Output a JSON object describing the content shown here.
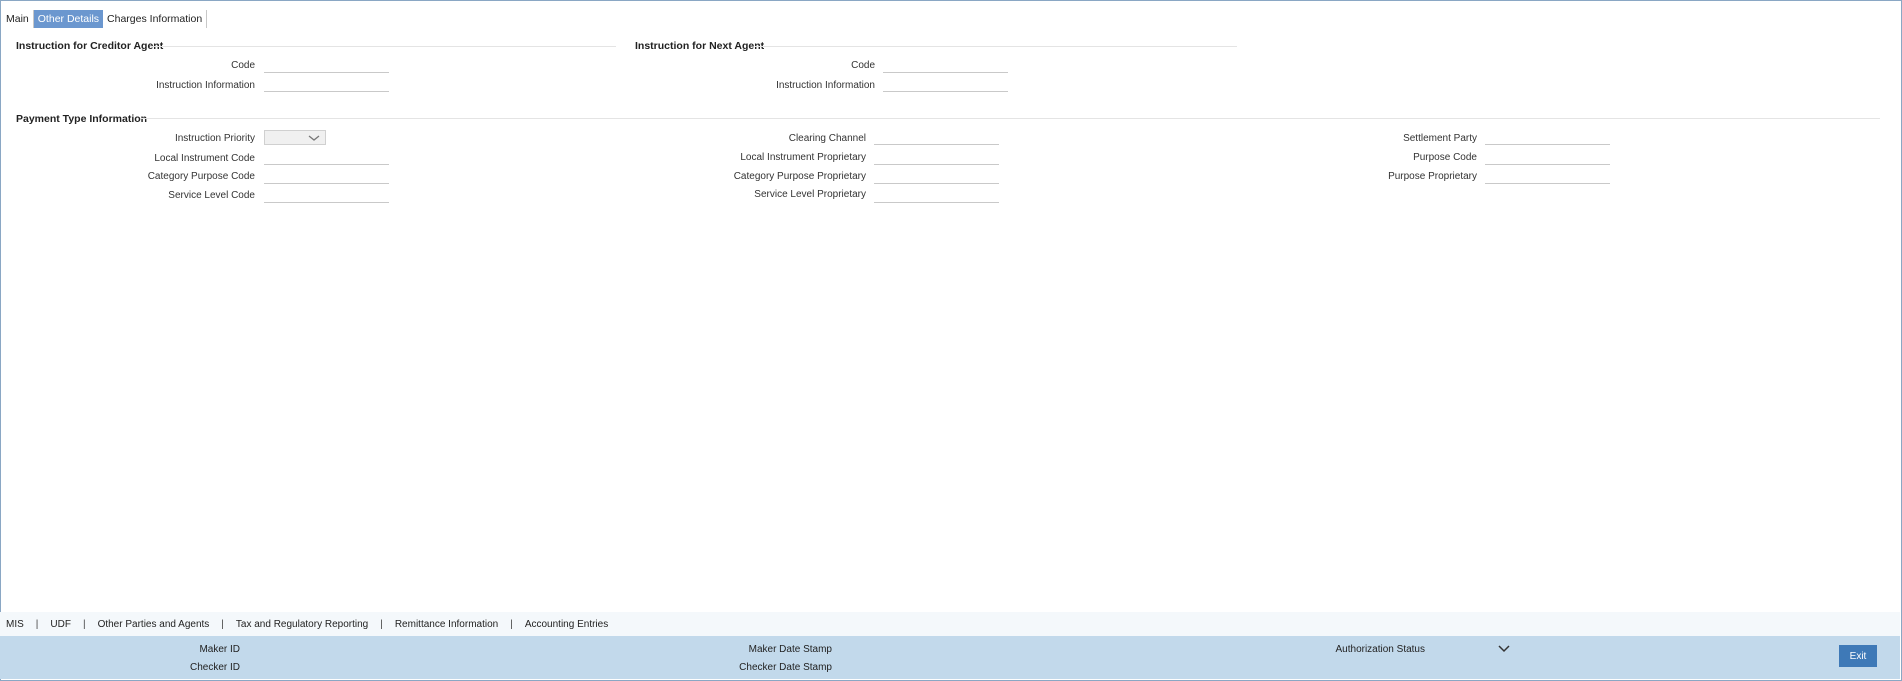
{
  "tabs": [
    "Main",
    "Other Details",
    "Charges Information"
  ],
  "creditor_agent": {
    "title": "Instruction for Creditor Agent",
    "code_label": "Code",
    "code_value": "",
    "info_label": "Instruction Information",
    "info_value": ""
  },
  "next_agent": {
    "title": "Instruction for Next Agent",
    "code_label": "Code",
    "code_value": "",
    "info_label": "Instruction Information",
    "info_value": ""
  },
  "payment_type": {
    "title": "Payment Type Information",
    "instruction_priority": "Instruction Priority",
    "local_instrument_code": "Local Instrument Code",
    "category_purpose_code": "Category Purpose Code",
    "service_level_code": "Service Level Code",
    "clearing_channel": "Clearing Channel",
    "local_instrument_proprietary": "Local Instrument Proprietary",
    "category_purpose_proprietary": "Category Purpose Proprietary",
    "service_level_proprietary": "Service Level Proprietary",
    "settlement_party": "Settlement Party",
    "purpose_code": "Purpose Code",
    "purpose_proprietary": "Purpose Proprietary"
  },
  "bottom_links": [
    "MIS",
    "UDF",
    "Other Parties and Agents",
    "Tax and Regulatory Reporting",
    "Remittance Information",
    "Accounting Entries"
  ],
  "footer": {
    "maker_id": "Maker ID",
    "checker_id": "Checker ID",
    "maker_date_stamp": "Maker Date Stamp",
    "checker_date_stamp": "Checker Date Stamp",
    "authorization_status": "Authorization Status",
    "exit_label": "Exit"
  },
  "colors": {
    "active_tab": "#6b97cf",
    "footer_bg": "#c2d9eb",
    "exit_button": "#3e79b7"
  },
  "icons": {
    "dropdown": "chevron-down-icon"
  }
}
